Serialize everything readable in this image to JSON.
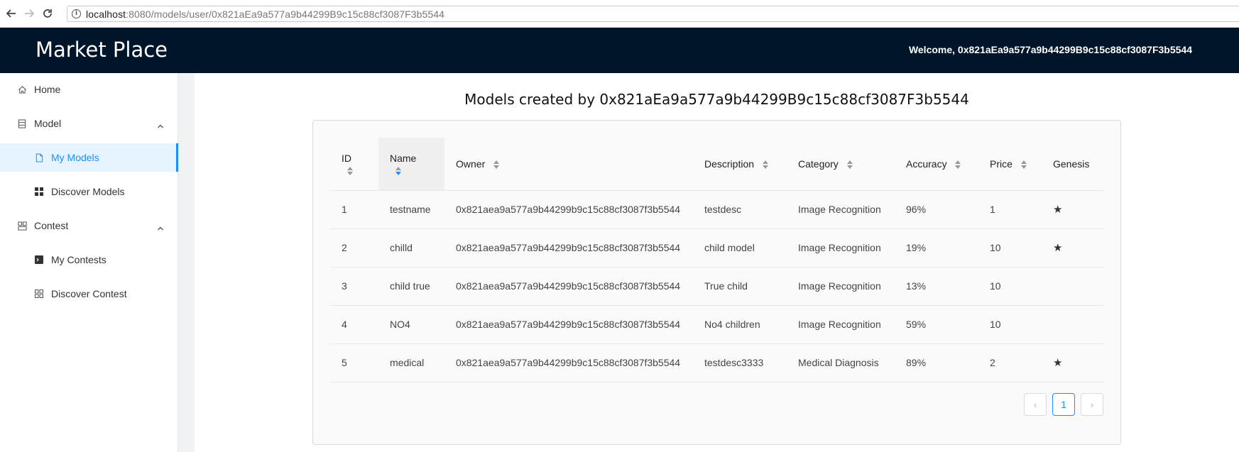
{
  "browser": {
    "url_host": "localhost",
    "url_rest": ":8080/models/user/0x821aEa9a577a9b44299B9c15c88cf3087F3b5544"
  },
  "header": {
    "brand": "Market Place",
    "welcome": "Welcome, 0x821aEa9a577a9b44299B9c15c88cf3087F3b5544"
  },
  "sidebar": {
    "home": "Home",
    "model": "Model",
    "my_models": "My Models",
    "discover_models": "Discover Models",
    "contest": "Contest",
    "my_contests": "My Contests",
    "discover_contest": "Discover Contest"
  },
  "main": {
    "title": "Models created by 0x821aEa9a577a9b44299B9c15c88cf3087F3b5544",
    "columns": {
      "id": "ID",
      "name": "Name",
      "owner": "Owner",
      "description": "Description",
      "category": "Category",
      "accuracy": "Accuracy",
      "price": "Price",
      "genesis": "Genesis"
    },
    "rows": [
      {
        "id": "1",
        "name": "testname",
        "owner": "0x821aea9a577a9b44299b9c15c88cf3087f3b5544",
        "description": "testdesc",
        "category": "Image Recognition",
        "accuracy": "96%",
        "price": "1",
        "genesis": "★"
      },
      {
        "id": "2",
        "name": "chilld",
        "owner": "0x821aea9a577a9b44299b9c15c88cf3087f3b5544",
        "description": "child model",
        "category": "Image Recognition",
        "accuracy": "19%",
        "price": "10",
        "genesis": "★"
      },
      {
        "id": "3",
        "name": "child true",
        "owner": "0x821aea9a577a9b44299b9c15c88cf3087f3b5544",
        "description": "True child",
        "category": "Image Recognition",
        "accuracy": "13%",
        "price": "10",
        "genesis": ""
      },
      {
        "id": "4",
        "name": "NO4",
        "owner": "0x821aea9a577a9b44299b9c15c88cf3087f3b5544",
        "description": "No4 children",
        "category": "Image Recognition",
        "accuracy": "59%",
        "price": "10",
        "genesis": ""
      },
      {
        "id": "5",
        "name": "medical",
        "owner": "0x821aea9a577a9b44299b9c15c88cf3087f3b5544",
        "description": "testdesc3333",
        "category": "Medical Diagnosis",
        "accuracy": "89%",
        "price": "2",
        "genesis": "★"
      }
    ],
    "pagination": {
      "prev": "‹",
      "current": "1",
      "next": "›"
    }
  },
  "colors": {
    "header_bg": "#001529",
    "accent": "#1890ff",
    "selected_bg": "#e6f4ff"
  }
}
